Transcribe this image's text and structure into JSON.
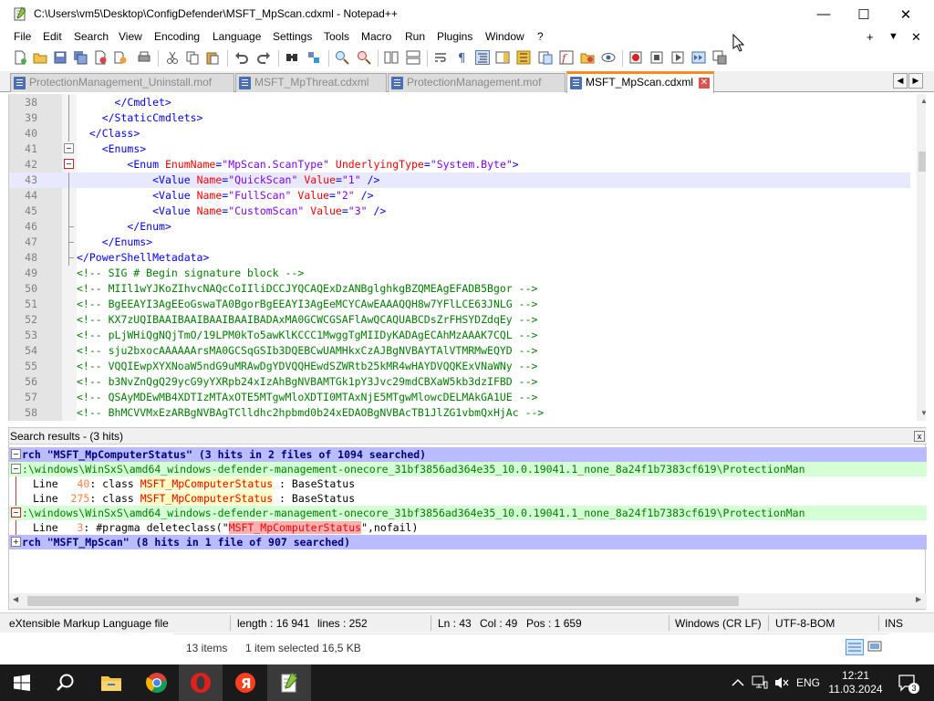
{
  "window": {
    "title": "C:\\Users\\vm5\\Desktop\\ConfigDefender\\MSFT_MpScan.cdxml - Notepad++",
    "minimize_glyph": "—",
    "maximize_glyph": "☐",
    "close_glyph": "✕"
  },
  "menu": {
    "items": [
      "File",
      "Edit",
      "Search",
      "View",
      "Encoding",
      "Language",
      "Settings",
      "Tools",
      "Macro",
      "Run",
      "Plugins",
      "Window",
      "?"
    ],
    "right_plus": "+",
    "right_down": "▼",
    "right_close": "✕"
  },
  "tabs": [
    {
      "label": "ProtectionManagement_Uninstall.mof",
      "active": false
    },
    {
      "label": "MSFT_MpThreat.cdxml",
      "active": false
    },
    {
      "label": "ProtectionManagement.mof",
      "active": false
    },
    {
      "label": "MSFT_MpScan.cdxml",
      "active": true
    }
  ],
  "tab_close_glyph": "✕",
  "tab_nav": {
    "left": "◀",
    "right": "▶"
  },
  "editor": {
    "current_line": 43,
    "lines": [
      {
        "n": "38",
        "parts": [
          [
            "txt",
            "      "
          ],
          [
            "tag",
            "</Cmdlet>"
          ]
        ]
      },
      {
        "n": "39",
        "parts": [
          [
            "txt",
            "    "
          ],
          [
            "tag",
            "</StaticCmdlets>"
          ]
        ]
      },
      {
        "n": "40",
        "parts": [
          [
            "txt",
            "  "
          ],
          [
            "tag",
            "</Class>"
          ]
        ]
      },
      {
        "n": "41",
        "parts": [
          [
            "txt",
            "    "
          ],
          [
            "tag",
            "<Enums>"
          ]
        ]
      },
      {
        "n": "42",
        "parts": [
          [
            "txt",
            "        "
          ],
          [
            "tag",
            "<Enum "
          ],
          [
            "attr",
            "EnumName"
          ],
          [
            "tag",
            "="
          ],
          [
            "val",
            "\"MpScan.ScanType\""
          ],
          [
            "txt",
            " "
          ],
          [
            "attr",
            "UnderlyingType"
          ],
          [
            "tag",
            "="
          ],
          [
            "val",
            "\"System.Byte\""
          ],
          [
            "tag",
            ">"
          ]
        ]
      },
      {
        "n": "43",
        "parts": [
          [
            "txt",
            "            "
          ],
          [
            "tag",
            "<Value "
          ],
          [
            "attr",
            "Name"
          ],
          [
            "tag",
            "="
          ],
          [
            "val",
            "\"QuickScan\""
          ],
          [
            "txt",
            " "
          ],
          [
            "attr",
            "Value"
          ],
          [
            "tag",
            "="
          ],
          [
            "val",
            "\"1\""
          ],
          [
            "tag",
            " />"
          ]
        ]
      },
      {
        "n": "44",
        "parts": [
          [
            "txt",
            "            "
          ],
          [
            "tag",
            "<Value "
          ],
          [
            "attr",
            "Name"
          ],
          [
            "tag",
            "="
          ],
          [
            "val",
            "\"FullScan\""
          ],
          [
            "txt",
            " "
          ],
          [
            "attr",
            "Value"
          ],
          [
            "tag",
            "="
          ],
          [
            "val",
            "\"2\""
          ],
          [
            "tag",
            " />"
          ]
        ]
      },
      {
        "n": "45",
        "parts": [
          [
            "txt",
            "            "
          ],
          [
            "tag",
            "<Value "
          ],
          [
            "attr",
            "Name"
          ],
          [
            "tag",
            "="
          ],
          [
            "val",
            "\"CustomScan\""
          ],
          [
            "txt",
            " "
          ],
          [
            "attr",
            "Value"
          ],
          [
            "tag",
            "="
          ],
          [
            "val",
            "\"3\""
          ],
          [
            "tag",
            " />"
          ]
        ]
      },
      {
        "n": "46",
        "parts": [
          [
            "txt",
            "        "
          ],
          [
            "tag",
            "</Enum>"
          ]
        ]
      },
      {
        "n": "47",
        "parts": [
          [
            "txt",
            "    "
          ],
          [
            "tag",
            "</Enums>"
          ]
        ]
      },
      {
        "n": "48",
        "parts": [
          [
            "tag",
            "</PowerShellMetadata>"
          ]
        ]
      },
      {
        "n": "49",
        "parts": [
          [
            "com",
            "<!-- SIG # Begin signature block -->"
          ]
        ]
      },
      {
        "n": "50",
        "parts": [
          [
            "com",
            "<!-- MIIl1wYJKoZIhvcNAQcCoIIliDCCJYQCAQExDzANBglghkgBZQMEAgEFADB5Bgor -->"
          ]
        ]
      },
      {
        "n": "51",
        "parts": [
          [
            "com",
            "<!-- BgEEAYI3AgEEoGswaTA0BgorBgEEAYI3AgEeMCYCAwEAAAQQH8w7YFlLCE63JNLG -->"
          ]
        ]
      },
      {
        "n": "52",
        "parts": [
          [
            "com",
            "<!-- KX7zUQIBAAIBAAIBAAIBAAIBADAxMA0GCWCGSAFlAwQCAQUABCDsZrFHSYDZdqEy -->"
          ]
        ]
      },
      {
        "n": "53",
        "parts": [
          [
            "com",
            "<!-- pLjWHiQgNQjTmO/19LPM0kTo5awKlKCCC1MwggTgMIIDyKADAgECAhMzAAAK7CQL -->"
          ]
        ]
      },
      {
        "n": "54",
        "parts": [
          [
            "com",
            "<!-- sju2bxocAAAAAArsMA0GCSqGSIb3DQEBCwUAMHkxCzAJBgNVBAYTAlVTMRMwEQYD -->"
          ]
        ]
      },
      {
        "n": "55",
        "parts": [
          [
            "com",
            "<!-- VQQIEwpXYXNoaW5ndG9uMRAwDgYDVQQHEwdSZWRtb25kMR4wHAYDVQQKExVNaWNy -->"
          ]
        ]
      },
      {
        "n": "56",
        "parts": [
          [
            "com",
            "<!-- b3NvZnQgQ29ycG9yYXRpb24xIzAhBgNVBAMTGk1pY3Jvc29mdCBXaW5kb3dzIFBD -->"
          ]
        ]
      },
      {
        "n": "57",
        "parts": [
          [
            "com",
            "<!-- QSAyMDEwMB4XDTIzMTAxOTE5MTgwMloXDTI0MTAxNjE5MTgwMlowcDELMAkGA1UE -->"
          ]
        ]
      },
      {
        "n": "58",
        "parts": [
          [
            "com",
            "<!-- BhMCVVMxEzARBgNVBAgTClldhc2hpbmd0b24xEDAOBgNVBAcTB1JlZG1vbmQxHjAc -->"
          ]
        ]
      }
    ]
  },
  "search_results": {
    "header": "Search results - (3 hits)",
    "close_glyph": "x",
    "lines": [
      {
        "kind": "search",
        "text": "rch \"MSFT_MpComputerStatus\" (3 hits in 2 files of 1094 searched)"
      },
      {
        "kind": "file",
        "text": ":\\windows\\WinSxS\\amd64_windows-defender-management-onecore_31bf3856ad364e35_10.0.19041.1_none_8a24f1b7383cf619\\ProtectionMan"
      },
      {
        "kind": "hit",
        "pre": "Line  ",
        "num": " 40",
        "mid": ": class ",
        "hl": "MSFT_MpComputerStatus",
        "post": " : BaseStatus"
      },
      {
        "kind": "hit",
        "pre": "Line  ",
        "num": "275",
        "mid": ": class ",
        "hl": "MSFT_MpComputerStatus",
        "post": " : BaseStatus"
      },
      {
        "kind": "file",
        "text": ":\\windows\\WinSxS\\amd64_windows-defender-management-onecore_31bf3856ad364e35_10.0.19041.1_none_8a24f1b7383cf619\\ProtectionMan"
      },
      {
        "kind": "hit2",
        "pre": "Line  ",
        "num": " 3",
        "mid": ": #pragma deleteclass(\"",
        "hl": "MSFT_MpComputerStatus",
        "post": "\",nofail)"
      },
      {
        "kind": "search",
        "text": "rch \"MSFT_MpScan\" (8 hits in 1 file of 907 searched)"
      }
    ]
  },
  "statusbar": {
    "filetype": "eXtensible Markup Language file",
    "length": "length : 16 941",
    "lines": "lines : 252",
    "ln": "Ln : 43",
    "col": "Col : 49",
    "pos": "Pos : 1 659",
    "eol": "Windows (CR LF)",
    "encoding": "UTF-8-BOM",
    "mode": "INS"
  },
  "explorer": {
    "items": "13 items",
    "selected": "1 item selected  16,5 KB"
  },
  "taskbar": {
    "lang": "ENG",
    "time": "12:21",
    "date": "11.03.2024",
    "notifications": "3"
  },
  "colors": {
    "accent_tab": "#fa8a1e",
    "taskbar": "#1a1a1a",
    "search_bg": "#bbbbff",
    "file_bg": "#d5ffd5"
  }
}
